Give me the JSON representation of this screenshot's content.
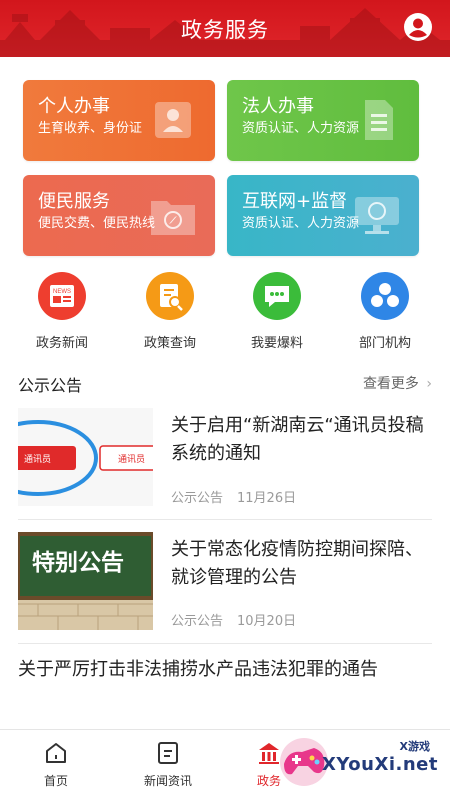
{
  "header": {
    "title": "政务服务"
  },
  "cards": [
    {
      "title": "个人办事",
      "subtitle": "生育收养、身份证"
    },
    {
      "title": "法人办事",
      "subtitle": "资质认证、人力资源"
    },
    {
      "title": "便民服务",
      "subtitle": "便民交费、便民热线"
    },
    {
      "title": "互联网+监督",
      "subtitle": "资质认证、人力资源"
    }
  ],
  "quick": [
    {
      "label": "政务新闻",
      "icon": "news-icon",
      "color": "#ee3e2f",
      "badge": "NEWS"
    },
    {
      "label": "政策查询",
      "icon": "policy-search-icon",
      "color": "#f59a16"
    },
    {
      "label": "我要爆料",
      "icon": "chat-icon",
      "color": "#3bbc3a"
    },
    {
      "label": "部门机构",
      "icon": "org-icon",
      "color": "#2f86e6"
    }
  ],
  "section": {
    "title": "公示公告",
    "more": "查看更多"
  },
  "news": [
    {
      "title": "关于启用“新湖南云“通讯员投稿系统的通知",
      "category": "公示公告",
      "date": "11月26日",
      "thumb_text_a": "通讯员",
      "thumb_text_b": "通讯员"
    },
    {
      "title": "关于常态化疫情防控期间探陪、就诊管理的公告",
      "category": "公示公告",
      "date": "10月20日",
      "thumb_text": "特别公告"
    },
    {
      "title": "关于严厉打击非法捕捞水产品违法犯罪的通告"
    }
  ],
  "tabs": [
    {
      "label": "首页",
      "active": false
    },
    {
      "label": "新闻资讯",
      "active": false
    },
    {
      "label": "政务",
      "active": true
    }
  ],
  "watermark": {
    "text": "XYouXi.net",
    "small": "X游戏"
  }
}
